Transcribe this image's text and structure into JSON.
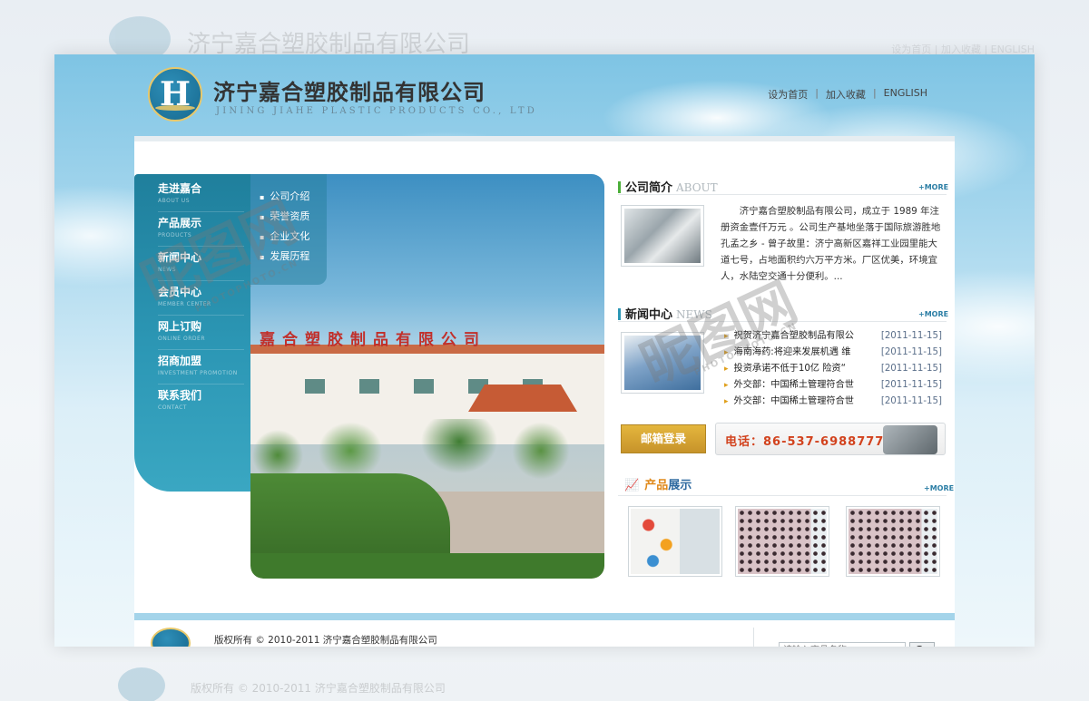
{
  "background": {
    "ghost_title": "济宁嘉合塑胶制品有限公司",
    "ghost_links": "设为首页 | 加入收藏 | ENGLISH",
    "ghost_footer": "版权所有 © 2010-2011   济宁嘉合塑胶制品有限公司"
  },
  "header": {
    "logo_letter": "H",
    "company_cn": "济宁嘉合塑胶制品有限公司",
    "company_en": "JINING JIAHE PLASTIC PRODUCTS CO., LTD",
    "links": [
      "设为首页",
      "加入收藏",
      "ENGLISH"
    ],
    "separator": "|"
  },
  "sidebar": {
    "items": [
      {
        "cn": "走进嘉合",
        "en": "ABOUT US"
      },
      {
        "cn": "产品展示",
        "en": "PRODUCTS"
      },
      {
        "cn": "新闻中心",
        "en": "NEWS"
      },
      {
        "cn": "会员中心",
        "en": "MEMBER CENTER"
      },
      {
        "cn": "网上订购",
        "en": "ONLINE ORDER"
      },
      {
        "cn": "招商加盟",
        "en": "INVESTMENT PROMOTION"
      },
      {
        "cn": "联系我们",
        "en": "CONTACT"
      }
    ]
  },
  "submenu": {
    "items": [
      "公司介绍",
      "荣誉资质",
      "企业文化",
      "发展历程"
    ]
  },
  "banner": {
    "building_sign": "嘉合塑胶制品有限公司"
  },
  "about": {
    "title": "公司简介",
    "title_en": "ABOUT",
    "more": "+MORE",
    "text": "济宁嘉合塑胶制品有限公司，成立于 1989 年注册资金壹仟万元 。公司生产基地坐落于国际旅游胜地孔孟之乡 - 曾子故里：济宁高新区嘉祥工业园里能大道七号，占地面积约六万平方米。厂区优美，环境宜人，水陆空交通十分便利。..."
  },
  "news": {
    "title": "新闻中心",
    "title_en": "NEWS",
    "more": "+MORE",
    "items": [
      {
        "text": "祝贺济宁嘉合塑胶制品有限公",
        "date": "[2011-11-15]"
      },
      {
        "text": "海南海药:将迎来发展机遇 维",
        "date": "[2011-11-15]"
      },
      {
        "text": "投资承诺不低于10亿 险资“",
        "date": "[2011-11-15]"
      },
      {
        "text": "外交部：中国稀土管理符合世",
        "date": "[2011-11-15]"
      },
      {
        "text": "外交部：中国稀土管理符合世",
        "date": "[2011-11-15]"
      }
    ]
  },
  "contact": {
    "mail_login": "邮箱登录",
    "phone": "电话：86-537-6988777"
  },
  "products": {
    "title_a": "产品",
    "title_b": "展示",
    "more": "+MORE"
  },
  "footer": {
    "copyright": "版权所有 © 2010-2011   济宁嘉合塑胶制品有限公司",
    "search_placeholder": "请输入商品名称",
    "go": "Go"
  },
  "watermark": {
    "text": "昵图网",
    "url": "PHOTOPHOTO.CN"
  },
  "colors": {
    "accent_blue": "#2c97b5",
    "phone_red": "#d2421d",
    "mail_gold": "#d6a534"
  }
}
